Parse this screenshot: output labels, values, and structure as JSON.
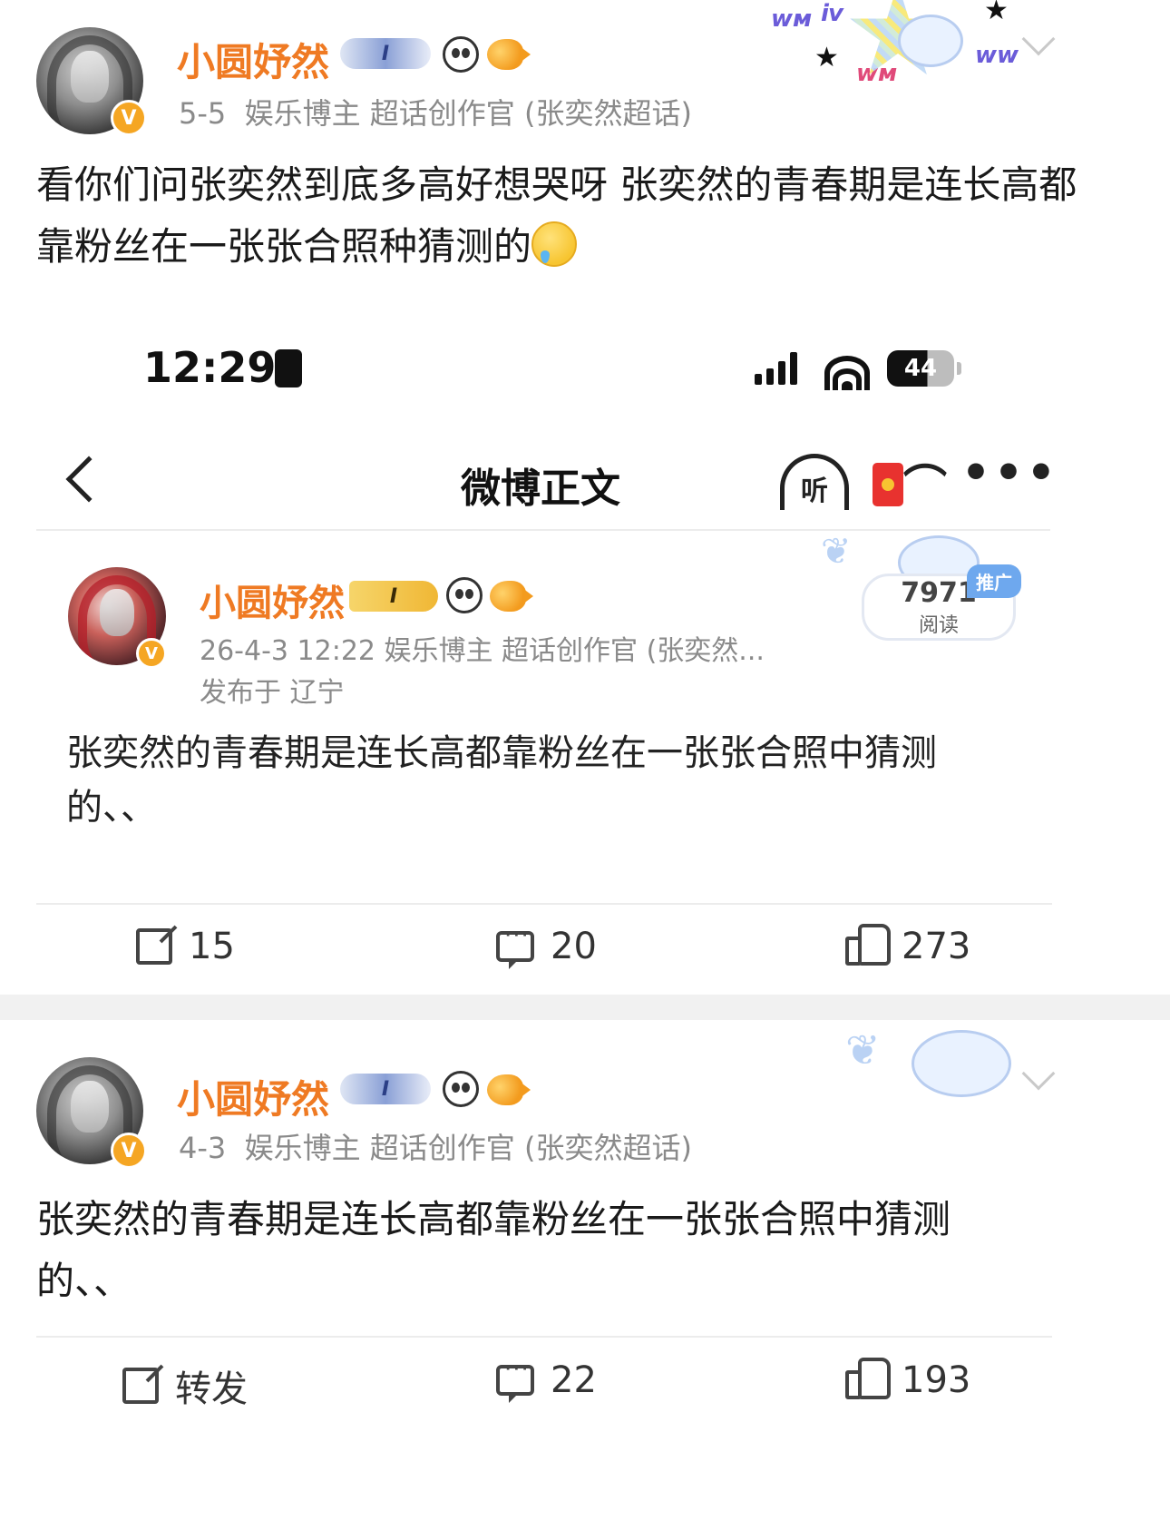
{
  "post1": {
    "username": "小圆妤然",
    "level_badge": "I",
    "date": "5-5",
    "meta": "娱乐博主 超话创作官 (张奕然超话)",
    "text": "看你们问张奕然到底多高好想哭呀 张奕然的青春期是连长高都靠粉丝在一张张合照种猜测的",
    "avatar_badge": "V"
  },
  "screenshot": {
    "status_time": "12:29",
    "battery": "44",
    "nav_title": "微博正文",
    "listen_label": "听",
    "inner_post": {
      "username": "小圆妤然",
      "level_badge": "I",
      "meta": "26-4-3 12:22  娱乐博主 超话创作官 (张奕然...",
      "location": "发布于 辽宁",
      "reads_count": "7971",
      "reads_label": "阅读",
      "promo_tag": "推广",
      "text": "张奕然的青春期是连长高都靠粉丝在一张张合照中猜测的、、",
      "avatar_badge": "V"
    },
    "actions": {
      "share_count": "15",
      "comment_count": "20",
      "like_count": "273"
    }
  },
  "post2": {
    "username": "小圆妤然",
    "level_badge": "I",
    "date": "4-3",
    "meta": "娱乐博主 超话创作官 (张奕然超话)",
    "text": "张奕然的青春期是连长高都靠粉丝在一张张合照中猜测的、、",
    "avatar_badge": "V",
    "actions": {
      "share_label": "转发",
      "comment_count": "22",
      "like_count": "193"
    }
  },
  "colors": {
    "username": "#ef7a23",
    "verified_badge": "#f5a623",
    "meta_gray": "#8a8a8a"
  }
}
